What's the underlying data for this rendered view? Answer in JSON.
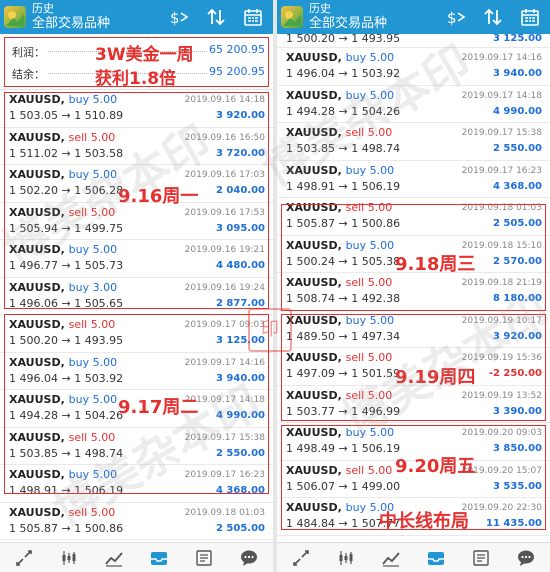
{
  "colors": {
    "header": "#2196d3",
    "buy": "#1e6fd9",
    "sell": "#e53030",
    "profit": "#1e6fd9",
    "loss": "#e53030",
    "annotation": "#e53030"
  },
  "left_panel": {
    "header": {
      "subtitle": "历史",
      "title": "全部交易品种",
      "icons": [
        "app-logo-icon",
        "exchange-icon",
        "sort-icon",
        "calendar-icon"
      ]
    },
    "summary": {
      "profit_label": "利润：",
      "profit_value": "65 200.95",
      "balance_label": "结余：",
      "balance_value": "95 200.95"
    },
    "trades": [
      {
        "symbol": "XAUUSD,",
        "side": "buy 5.00",
        "prices": "1 503.05 → 1 510.89",
        "datetime": "2019.09.16 14:18",
        "pl": "3 920.00"
      },
      {
        "symbol": "XAUUSD,",
        "side": "sell 5.00",
        "prices": "1 511.02 → 1 503.58",
        "datetime": "2019.09.16 16:50",
        "pl": "3 720.00"
      },
      {
        "symbol": "XAUUSD,",
        "side": "buy 5.00",
        "prices": "1 502.20 → 1 506.28",
        "datetime": "2019.09.16 17:03",
        "pl": "2 040.00"
      },
      {
        "symbol": "XAUUSD,",
        "side": "sell 5.00",
        "prices": "1 505.94 → 1 499.75",
        "datetime": "2019.09.16 17:53",
        "pl": "3 095.00"
      },
      {
        "symbol": "XAUUSD,",
        "side": "buy 5.00",
        "prices": "1 496.77 → 1 505.73",
        "datetime": "2019.09.16 19:21",
        "pl": "4 480.00"
      },
      {
        "symbol": "XAUUSD,",
        "side": "buy 3.00",
        "prices": "1 496.06 → 1 505.65",
        "datetime": "2019.09.16 19:24",
        "pl": "2 877.00"
      },
      {
        "symbol": "XAUUSD,",
        "side": "sell 5.00",
        "prices": "1 500.20 → 1 493.95",
        "datetime": "2019.09.17 09:03",
        "pl": "3 125.00"
      },
      {
        "symbol": "XAUUSD,",
        "side": "buy 5.00",
        "prices": "1 496.04 → 1 503.92",
        "datetime": "2019.09.17 14:16",
        "pl": "3 940.00"
      },
      {
        "symbol": "XAUUSD,",
        "side": "buy 5.00",
        "prices": "1 494.28 → 1 504.26",
        "datetime": "2019.09.17 14:18",
        "pl": "4 990.00"
      },
      {
        "symbol": "XAUUSD,",
        "side": "sell 5.00",
        "prices": "1 503.85 → 1 498.74",
        "datetime": "2019.09.17 15:38",
        "pl": "2 550.00"
      },
      {
        "symbol": "XAUUSD,",
        "side": "buy 5.00",
        "prices": "1 498.91 → 1 506.19",
        "datetime": "2019.09.17 16:23",
        "pl": "4 368.00"
      },
      {
        "symbol": "XAUUSD,",
        "side": "sell 5.00",
        "prices": "1 505.87 → 1 500.86",
        "datetime": "2019.09.18 01:03",
        "pl": "2 505.00"
      }
    ],
    "annotations": {
      "week": "3W美金一周",
      "gain": "获利1.8倍",
      "day1": "9.16周一",
      "day2": "9.17周二"
    }
  },
  "right_panel": {
    "header": {
      "subtitle": "历史",
      "title": "全部交易品种",
      "icons": [
        "app-logo-icon",
        "exchange-icon",
        "sort-icon",
        "calendar-icon"
      ]
    },
    "top_partial": {
      "prices": "1 500.20 → 1 493.95",
      "pl": "3 125.00"
    },
    "trades": [
      {
        "symbol": "XAUUSD,",
        "side": "buy 5.00",
        "prices": "1 496.04 → 1 503.92",
        "datetime": "2019.09.17 14:16",
        "pl": "3 940.00"
      },
      {
        "symbol": "XAUUSD,",
        "side": "buy 5.00",
        "prices": "1 494.28 → 1 504.26",
        "datetime": "2019.09.17 14:18",
        "pl": "4 990.00"
      },
      {
        "symbol": "XAUUSD,",
        "side": "sell 5.00",
        "prices": "1 503.85 → 1 498.74",
        "datetime": "2019.09.17 15:38",
        "pl": "2 550.00"
      },
      {
        "symbol": "XAUUSD,",
        "side": "buy 5.00",
        "prices": "1 498.91 → 1 506.19",
        "datetime": "2019.09.17 16:23",
        "pl": "4 368.00"
      },
      {
        "symbol": "XAUUSD,",
        "side": "sell 5.00",
        "prices": "1 505.87 → 1 500.86",
        "datetime": "2019.09.18 01:03",
        "pl": "2 505.00"
      },
      {
        "symbol": "XAUUSD,",
        "side": "buy 5.00",
        "prices": "1 500.24 → 1 505.38",
        "datetime": "2019.09.18 15:10",
        "pl": "2 570.00"
      },
      {
        "symbol": "XAUUSD,",
        "side": "sell 5.00",
        "prices": "1 508.74 → 1 492.38",
        "datetime": "2019.09.18 21:19",
        "pl": "8 180.00"
      },
      {
        "symbol": "XAUUSD,",
        "side": "buy 5.00",
        "prices": "1 489.50 → 1 497.34",
        "datetime": "2019.09.19 10:17",
        "pl": "3 920.00"
      },
      {
        "symbol": "XAUUSD,",
        "side": "sell 5.00",
        "prices": "1 497.09 → 1 501.59",
        "datetime": "2019.09.19 15:36",
        "pl": "-2 250.00"
      },
      {
        "symbol": "XAUUSD,",
        "side": "sell 5.00",
        "prices": "1 503.77 → 1 496.99",
        "datetime": "2019.09.19 13:52",
        "pl": "3 390.00"
      },
      {
        "symbol": "XAUUSD,",
        "side": "buy 5.00",
        "prices": "1 498.49 → 1 506.19",
        "datetime": "2019.09.20 09:03",
        "pl": "3 850.00"
      },
      {
        "symbol": "XAUUSD,",
        "side": "sell 5.00",
        "prices": "1 506.07 → 1 499.00",
        "datetime": "2019.09.20 15:07",
        "pl": "3 535.00"
      },
      {
        "symbol": "XAUUSD,",
        "side": "buy 5.00",
        "prices": "1 484.84 → 1 507.77",
        "datetime": "2019.09.20 22:30",
        "pl": "11 435.00"
      }
    ],
    "annotations": {
      "day3": "9.18周三",
      "day4": "9.19周四",
      "day5": "9.20周五",
      "strategy": "中长线布局"
    }
  },
  "bottom_tabs": [
    "trade-icon",
    "quotes-icon",
    "chart-icon",
    "history-icon",
    "news-icon",
    "chat-icon"
  ],
  "watermark": {
    "text": "博美杂本印",
    "seal_text": "印"
  }
}
